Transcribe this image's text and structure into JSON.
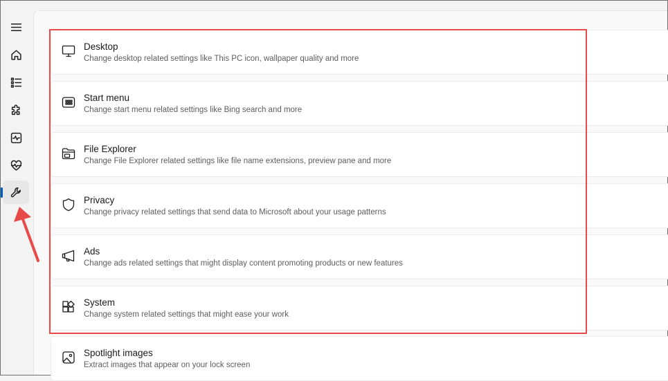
{
  "sidebar": {
    "items": [
      {
        "icon": "hamburger-menu-icon",
        "active": false
      },
      {
        "icon": "home-icon",
        "active": false
      },
      {
        "icon": "list-icon",
        "active": false
      },
      {
        "icon": "puzzle-icon",
        "active": false
      },
      {
        "icon": "activity-monitor-icon",
        "active": false
      },
      {
        "icon": "heart-pulse-icon",
        "active": false
      },
      {
        "icon": "wrench-icon",
        "active": true
      }
    ],
    "accent_color": "#005fb8"
  },
  "settings": {
    "desktop": {
      "title": "Desktop",
      "description": "Change desktop related settings like This PC icon, wallpaper quality and more",
      "icon": "monitor-icon"
    },
    "start_menu": {
      "title": "Start menu",
      "description": "Change start menu related settings like Bing search and more",
      "icon": "start-menu-icon"
    },
    "file_explorer": {
      "title": "File Explorer",
      "description": "Change File Explorer related settings like file name extensions, preview pane and more",
      "icon": "folder-icon"
    },
    "privacy": {
      "title": "Privacy",
      "description": "Change privacy related settings that send data to Microsoft about your usage patterns",
      "icon": "shield-icon"
    },
    "ads": {
      "title": "Ads",
      "description": "Change ads related settings that might display content promoting products or new features",
      "icon": "megaphone-icon"
    },
    "system": {
      "title": "System",
      "description": "Change system related settings that might ease your work",
      "icon": "apps-icon"
    },
    "spotlight": {
      "title": "Spotlight images",
      "description": "Extract images that appear on your lock screen",
      "icon": "image-icon"
    }
  },
  "annotation": {
    "highlight_color": "#e84a4a",
    "arrow_color": "#e84a4a"
  }
}
